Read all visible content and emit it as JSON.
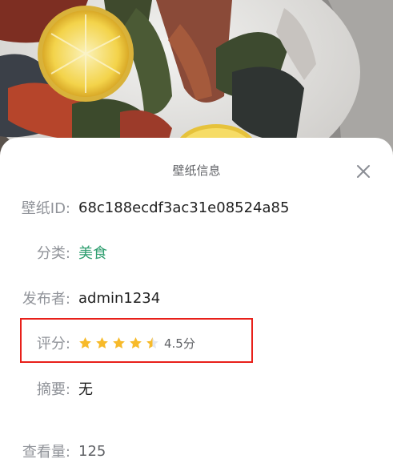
{
  "dialog": {
    "title": "壁纸信息"
  },
  "fields": {
    "wallpaper_id": {
      "label": "壁纸ID:",
      "value": "68c188ecdf3ac31e08524a85"
    },
    "category": {
      "label": "分类:",
      "value": "美食"
    },
    "publisher": {
      "label": "发布者:",
      "value": "admin1234"
    },
    "rating": {
      "label": "评分:",
      "value": 4.5,
      "max": 5,
      "score_text": "4.5分"
    },
    "summary": {
      "label": "摘要:",
      "value": "无"
    },
    "views": {
      "label": "查看量:",
      "value": "125"
    }
  },
  "colors": {
    "accent": "#2e9e6f",
    "star": "#f7ba2a",
    "highlight_border": "#e8201a"
  },
  "icons": {
    "close": "close-icon",
    "star": "star-icon"
  }
}
